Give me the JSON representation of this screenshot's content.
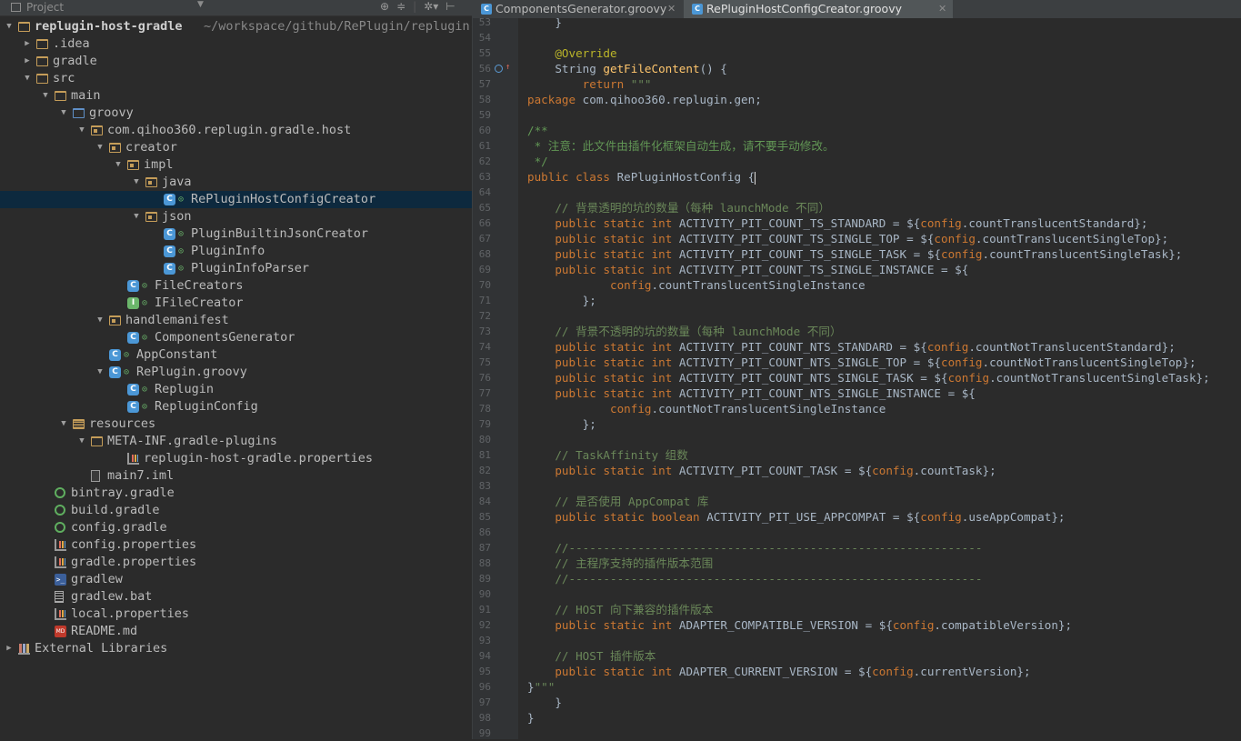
{
  "project_panel": {
    "title": "Project",
    "root_label": "replugin-host-gradle",
    "root_path": "~/workspace/github/RePlugin/replugin-h",
    "items": [
      {
        "label": "replugin-host-gradle",
        "icon": "folder-icon",
        "depth": 0,
        "arrow": "expanded"
      },
      {
        "label": ".idea",
        "icon": "folder-icon",
        "depth": 1,
        "arrow": "collapsed"
      },
      {
        "label": "gradle",
        "icon": "folder-icon",
        "depth": 1,
        "arrow": "collapsed"
      },
      {
        "label": "src",
        "icon": "folder-icon",
        "depth": 1,
        "arrow": "expanded"
      },
      {
        "label": "main",
        "icon": "folder-icon",
        "depth": 2,
        "arrow": "expanded"
      },
      {
        "label": "groovy",
        "icon": "source-folder-icon",
        "depth": 3,
        "arrow": "expanded"
      },
      {
        "label": "com.qihoo360.replugin.gradle.host",
        "icon": "package-icon",
        "depth": 4,
        "arrow": "expanded"
      },
      {
        "label": "creator",
        "icon": "package-icon",
        "depth": 5,
        "arrow": "expanded"
      },
      {
        "label": "impl",
        "icon": "package-icon",
        "depth": 6,
        "arrow": "expanded"
      },
      {
        "label": "java",
        "icon": "package-icon",
        "depth": 7,
        "arrow": "expanded"
      },
      {
        "label": "RePluginHostConfigCreator",
        "icon": "class-icon",
        "depth": 8,
        "arrow": "none",
        "selected": true
      },
      {
        "label": "json",
        "icon": "package-icon",
        "depth": 7,
        "arrow": "expanded"
      },
      {
        "label": "PluginBuiltinJsonCreator",
        "icon": "class-icon",
        "depth": 8,
        "arrow": "none"
      },
      {
        "label": "PluginInfo",
        "icon": "class-icon",
        "depth": 8,
        "arrow": "none"
      },
      {
        "label": "PluginInfoParser",
        "icon": "class-icon",
        "depth": 8,
        "arrow": "none"
      },
      {
        "label": "FileCreators",
        "icon": "class-icon",
        "depth": 6,
        "arrow": "none"
      },
      {
        "label": "IFileCreator",
        "icon": "interface-icon",
        "depth": 6,
        "arrow": "none"
      },
      {
        "label": "handlemanifest",
        "icon": "package-icon",
        "depth": 5,
        "arrow": "expanded"
      },
      {
        "label": "ComponentsGenerator",
        "icon": "class-icon",
        "depth": 6,
        "arrow": "none"
      },
      {
        "label": "AppConstant",
        "icon": "class-icon",
        "depth": 5,
        "arrow": "none"
      },
      {
        "label": "RePlugin.groovy",
        "icon": "class-icon",
        "depth": 5,
        "arrow": "expanded"
      },
      {
        "label": "Replugin",
        "icon": "class-icon",
        "depth": 6,
        "arrow": "none"
      },
      {
        "label": "RepluginConfig",
        "icon": "class-icon",
        "depth": 6,
        "arrow": "none"
      },
      {
        "label": "resources",
        "icon": "resources-folder-icon",
        "depth": 3,
        "arrow": "expanded"
      },
      {
        "label": "META-INF.gradle-plugins",
        "icon": "folder-icon",
        "depth": 4,
        "arrow": "expanded"
      },
      {
        "label": "replugin-host-gradle.properties",
        "icon": "properties-icon",
        "depth": 6,
        "arrow": "none"
      },
      {
        "label": "main7.iml",
        "icon": "iml-icon",
        "depth": 4,
        "arrow": "none"
      },
      {
        "label": "bintray.gradle",
        "icon": "gradle-icon",
        "depth": 2,
        "arrow": "none"
      },
      {
        "label": "build.gradle",
        "icon": "gradle-icon",
        "depth": 2,
        "arrow": "none"
      },
      {
        "label": "config.gradle",
        "icon": "gradle-icon",
        "depth": 2,
        "arrow": "none"
      },
      {
        "label": "config.properties",
        "icon": "properties-icon",
        "depth": 2,
        "arrow": "none"
      },
      {
        "label": "gradle.properties",
        "icon": "properties-icon",
        "depth": 2,
        "arrow": "none"
      },
      {
        "label": "gradlew",
        "icon": "shell-icon",
        "depth": 2,
        "arrow": "none"
      },
      {
        "label": "gradlew.bat",
        "icon": "text-file-icon",
        "depth": 2,
        "arrow": "none"
      },
      {
        "label": "local.properties",
        "icon": "properties-icon",
        "depth": 2,
        "arrow": "none"
      },
      {
        "label": "README.md",
        "icon": "markdown-icon",
        "depth": 2,
        "arrow": "none"
      },
      {
        "label": "External Libraries",
        "icon": "libraries-icon",
        "depth": 0,
        "arrow": "collapsed"
      }
    ]
  },
  "tabs": [
    {
      "label": "ComponentsGenerator.groovy",
      "active": false,
      "icon_letter": "C"
    },
    {
      "label": "RePluginHostConfigCreator.groovy",
      "active": true,
      "icon_letter": "C"
    }
  ],
  "editor": {
    "lines": [
      {
        "n": "53",
        "text": "    }"
      },
      {
        "n": "54",
        "text": ""
      },
      {
        "n": "55",
        "text": "    @Override"
      },
      {
        "n": "56",
        "text": "    String getFileContent() {"
      },
      {
        "n": "57",
        "text": "        return \"\"\""
      },
      {
        "n": "58",
        "text": "package com.qihoo360.replugin.gen;"
      },
      {
        "n": "59",
        "text": ""
      },
      {
        "n": "60",
        "text": "/**"
      },
      {
        "n": "61",
        "text": " * 注意：此文件由插件化框架自动生成，请不要手动修改。"
      },
      {
        "n": "62",
        "text": " */"
      },
      {
        "n": "63",
        "text": "public class RePluginHostConfig {"
      },
      {
        "n": "64",
        "text": ""
      },
      {
        "n": "65",
        "text": "    // 背景透明的坑的数量（每种 launchMode 不同）"
      },
      {
        "n": "66",
        "text": "    public static int ACTIVITY_PIT_COUNT_TS_STANDARD = ${config.countTranslucentStandard};"
      },
      {
        "n": "67",
        "text": "    public static int ACTIVITY_PIT_COUNT_TS_SINGLE_TOP = ${config.countTranslucentSingleTop};"
      },
      {
        "n": "68",
        "text": "    public static int ACTIVITY_PIT_COUNT_TS_SINGLE_TASK = ${config.countTranslucentSingleTask};"
      },
      {
        "n": "69",
        "text": "    public static int ACTIVITY_PIT_COUNT_TS_SINGLE_INSTANCE = ${"
      },
      {
        "n": "70",
        "text": "            config.countTranslucentSingleInstance"
      },
      {
        "n": "71",
        "text": "        };"
      },
      {
        "n": "72",
        "text": ""
      },
      {
        "n": "73",
        "text": "    // 背景不透明的坑的数量（每种 launchMode 不同）"
      },
      {
        "n": "74",
        "text": "    public static int ACTIVITY_PIT_COUNT_NTS_STANDARD = ${config.countNotTranslucentStandard};"
      },
      {
        "n": "75",
        "text": "    public static int ACTIVITY_PIT_COUNT_NTS_SINGLE_TOP = ${config.countNotTranslucentSingleTop};"
      },
      {
        "n": "76",
        "text": "    public static int ACTIVITY_PIT_COUNT_NTS_SINGLE_TASK = ${config.countNotTranslucentSingleTask};"
      },
      {
        "n": "77",
        "text": "    public static int ACTIVITY_PIT_COUNT_NTS_SINGLE_INSTANCE = ${"
      },
      {
        "n": "78",
        "text": "            config.countNotTranslucentSingleInstance"
      },
      {
        "n": "79",
        "text": "        };"
      },
      {
        "n": "80",
        "text": ""
      },
      {
        "n": "81",
        "text": "    // TaskAffinity 组数"
      },
      {
        "n": "82",
        "text": "    public static int ACTIVITY_PIT_COUNT_TASK = ${config.countTask};"
      },
      {
        "n": "83",
        "text": ""
      },
      {
        "n": "84",
        "text": "    // 是否使用 AppCompat 库"
      },
      {
        "n": "85",
        "text": "    public static boolean ACTIVITY_PIT_USE_APPCOMPAT = ${config.useAppCompat};"
      },
      {
        "n": "86",
        "text": ""
      },
      {
        "n": "87",
        "text": "    //------------------------------------------------------------"
      },
      {
        "n": "88",
        "text": "    // 主程序支持的插件版本范围"
      },
      {
        "n": "89",
        "text": "    //------------------------------------------------------------"
      },
      {
        "n": "90",
        "text": ""
      },
      {
        "n": "91",
        "text": "    // HOST 向下兼容的插件版本"
      },
      {
        "n": "92",
        "text": "    public static int ADAPTER_COMPATIBLE_VERSION = ${config.compatibleVersion};"
      },
      {
        "n": "93",
        "text": ""
      },
      {
        "n": "94",
        "text": "    // HOST 插件版本"
      },
      {
        "n": "95",
        "text": "    public static int ADAPTER_CURRENT_VERSION = ${config.currentVersion};"
      },
      {
        "n": "96",
        "text": "}\"\"\""
      },
      {
        "n": "97",
        "text": "    }"
      },
      {
        "n": "98",
        "text": "}"
      },
      {
        "n": "99",
        "text": ""
      }
    ]
  },
  "colors": {
    "background": "#2b2b2b",
    "keyword": "#cc7832",
    "annotation": "#bbb529",
    "method": "#ffc66d",
    "string": "#6a8759",
    "comment": "#629755",
    "selection": "#0d293e"
  }
}
